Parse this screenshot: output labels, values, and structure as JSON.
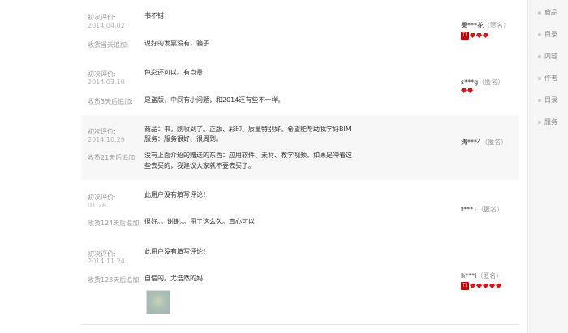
{
  "reviews": [
    {
      "initial_label": "初次评价:",
      "date": "2014.04.02",
      "initial_text": "书不错",
      "followup_label": "收货当天追加:",
      "followup_text": "说好的发票没有，骗子",
      "user": "果***花",
      "anon_label": "（匿名）",
      "level": "T1",
      "gems": 3
    },
    {
      "initial_label": "初次评价:",
      "date": "2014.03.10",
      "initial_text": "色彩还可以。有点贵",
      "followup_label": "收货3天后追加:",
      "followup_text": "是盗版，中间有小问题，和2014还有些不一样。",
      "user": "s***g",
      "anon_label": "（匿名）",
      "level": "",
      "gems": 2
    },
    {
      "initial_label": "初次评价:",
      "date": "2014.10.29",
      "initial_text_1": "商品：书，刚收到了。正版、彩印、质量特别好。希望能帮助我学好BIM",
      "initial_text_2": "服务：服务很好、很周到。",
      "followup_label": "收货21天后追加:",
      "followup_text_1": "没有上面介绍的赠送的东西：应用软件、素材、教学视频。如果是冲着这",
      "followup_text_2": "些去买的，我建议大家就不要去买了。",
      "user": "涛***4",
      "anon_label": "（匿名）",
      "level": "",
      "gems": 3
    },
    {
      "initial_label": "初次评价:",
      "date": "01.28",
      "initial_text": "此用户没有填写评论！",
      "followup_label": "收货124天后追加:",
      "followup_text": "很好。。谢谢。。用了这么久。真心可以",
      "user": "t***1",
      "anon_label": "（匿名）",
      "level": "",
      "gems": 0
    },
    {
      "initial_label": "初次评价:",
      "date": "2014.11.24",
      "initial_text": "此用户没有填写评论！",
      "followup_label": "收货128天后追加:",
      "followup_text": "自信的。尤浩然的妈",
      "user": "h***i",
      "anon_label": "（匿名）",
      "level": "T1",
      "gems": 5
    }
  ],
  "sidebar": {
    "items": [
      "商品",
      "目录",
      "内容",
      "作者",
      "目录",
      "服务"
    ]
  },
  "colors": {
    "badge": "#c40000",
    "gem": "#d41818",
    "shaded_row": "#f7f7f7"
  },
  "icons": {
    "level_badge": "level-badge-icon",
    "gem": "diamond-gem-icon",
    "photo": "review-photo-thumbnail"
  }
}
